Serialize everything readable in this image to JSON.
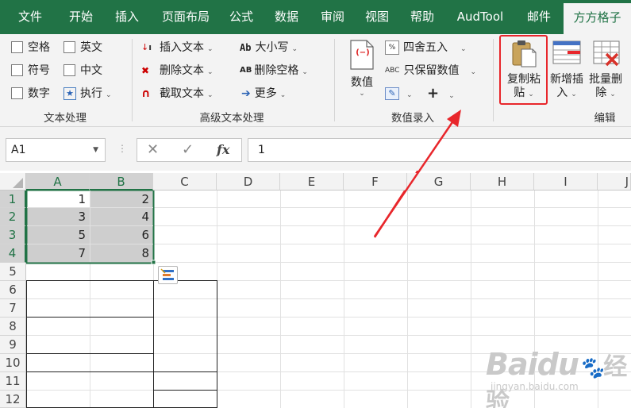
{
  "tabs": [
    "文件",
    "开始",
    "插入",
    "页面布局",
    "公式",
    "数据",
    "审阅",
    "视图",
    "帮助",
    "AudTool",
    "邮件",
    "方方格子"
  ],
  "active_tab": "方方格子",
  "ribbon": {
    "text_group": {
      "label": "文本处理",
      "checkboxes": [
        "空格",
        "英文",
        "符号",
        "中文",
        "数字"
      ],
      "execute": "执行"
    },
    "adv_group": {
      "label": "高级文本处理",
      "insert_text": "插入文本",
      "delete_text": "删除文本",
      "extract_text": "截取文本",
      "case": "大小写",
      "delete_spaces": "删除空格",
      "more": "更多",
      "case_icon": "Ab",
      "spaces_icon": "AB"
    },
    "num_group": {
      "label": "数值录入",
      "value": "数值",
      "value_icon": "(−)",
      "round": "四舍五入",
      "keep_value": "只保留数值",
      "keep_icon": "ABC",
      "plus": "+"
    },
    "edit_group": {
      "label": "编辑",
      "copy_paste_1": "复制粘",
      "copy_paste_2": "贴",
      "new_insert_1": "新增插",
      "new_insert_2": "入",
      "batch_delete_1": "批量删",
      "batch_delete_2": "除"
    }
  },
  "formula_bar": {
    "name_box": "A1",
    "cancel": "✕",
    "confirm": "✓",
    "fx": "fx",
    "value": "1"
  },
  "columns": [
    "A",
    "B",
    "C",
    "D",
    "E",
    "F",
    "G",
    "H",
    "I",
    "J"
  ],
  "rows": [
    "1",
    "2",
    "3",
    "4",
    "5",
    "6",
    "7",
    "8",
    "9",
    "10",
    "11",
    "12"
  ],
  "cells": {
    "A1": "1",
    "B1": "2",
    "A2": "3",
    "B2": "4",
    "A3": "5",
    "B3": "6",
    "A4": "7",
    "B4": "8"
  },
  "watermark": {
    "brand": "Baidu",
    "brand_cn": "经验",
    "url": "jingyan.baidu.com"
  },
  "colors": {
    "excel_green": "#217346",
    "highlight_red": "#e8262b",
    "selection_gray": "#c6c6c6"
  }
}
